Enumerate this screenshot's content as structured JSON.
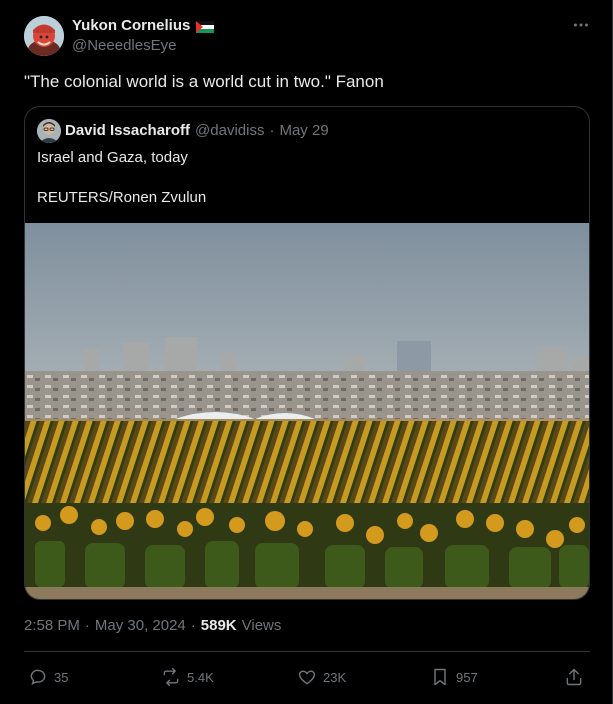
{
  "author": {
    "name": "Yukon Cornelius",
    "handle": "@NeeedlesEye",
    "flag_icon": "palestine-flag-icon"
  },
  "tweet": {
    "text": "\"The colonial world is a world cut in two.\" Fanon"
  },
  "quoted": {
    "name": "David Issacharoff",
    "handle": "@davidiss",
    "separator": "·",
    "date": "May 29",
    "line1": "Israel and Gaza, today",
    "line2": "REUTERS/Ronen Zvulun"
  },
  "meta": {
    "time": "2:58 PM",
    "sep1": "·",
    "date": "May 30, 2024",
    "sep2": "·",
    "views_count": "589K",
    "views_label": "Views"
  },
  "actions": {
    "replies": "35",
    "reposts": "5.4K",
    "likes": "23K",
    "bookmarks": "957"
  },
  "colors": {
    "background": "#000000",
    "text": "#e7e9ea",
    "secondary": "#71767b",
    "border": "#2f3336"
  }
}
